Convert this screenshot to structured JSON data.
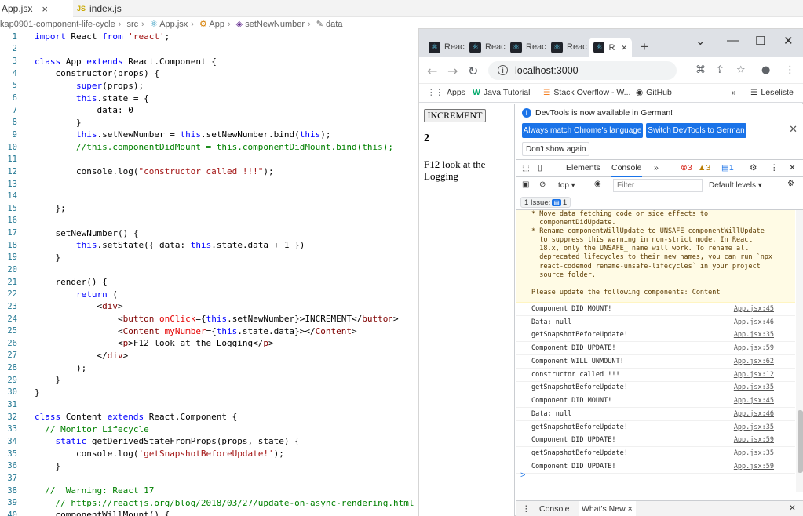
{
  "editor": {
    "tabs": [
      {
        "icon": "JS",
        "label": "App.jsx",
        "close": "×"
      },
      {
        "icon": "JS",
        "label": "index.js"
      }
    ],
    "breadcrumb": [
      "kap0901-component-life-cycle",
      "src",
      "App.jsx",
      "App",
      "setNewNumber",
      "data"
    ],
    "lines": [
      {
        "n": "1",
        "t": "import React from 'react';"
      },
      {
        "n": "2",
        "t": ""
      },
      {
        "n": "3",
        "t": "class App extends React.Component {"
      },
      {
        "n": "4",
        "t": "    constructor(props) {"
      },
      {
        "n": "5",
        "t": "        super(props);"
      },
      {
        "n": "6",
        "t": "        this.state = {"
      },
      {
        "n": "7",
        "t": "            data: 0"
      },
      {
        "n": "8",
        "t": "        }"
      },
      {
        "n": "9",
        "t": "        this.setNewNumber = this.setNewNumber.bind(this);"
      },
      {
        "n": "10",
        "t": "        //this.componentDidMount = this.componentDidMount.bind(this);"
      },
      {
        "n": "11",
        "t": ""
      },
      {
        "n": "12",
        "t": "        console.log(\"constructor called !!!\");"
      },
      {
        "n": "13",
        "t": ""
      },
      {
        "n": "14",
        "t": ""
      },
      {
        "n": "15",
        "t": "    };"
      },
      {
        "n": "16",
        "t": ""
      },
      {
        "n": "17",
        "t": "    setNewNumber() {"
      },
      {
        "n": "18",
        "t": "        this.setState({ data: this.state.data + 1 })"
      },
      {
        "n": "19",
        "t": "    }"
      },
      {
        "n": "20",
        "t": ""
      },
      {
        "n": "21",
        "t": "    render() {"
      },
      {
        "n": "22",
        "t": "        return ("
      },
      {
        "n": "23",
        "t": "            <div>"
      },
      {
        "n": "24",
        "t": "                <button onClick={this.setNewNumber}>INCREMENT</button>"
      },
      {
        "n": "25",
        "t": "                <Content myNumber={this.state.data}></Content>"
      },
      {
        "n": "26",
        "t": "                <p>F12 look at the Logging</p>"
      },
      {
        "n": "27",
        "t": "            </div>"
      },
      {
        "n": "28",
        "t": "        );"
      },
      {
        "n": "29",
        "t": "    }"
      },
      {
        "n": "30",
        "t": "}"
      },
      {
        "n": "31",
        "t": ""
      },
      {
        "n": "32",
        "t": "class Content extends React.Component {"
      },
      {
        "n": "33",
        "t": "  // Monitor Lifecycle"
      },
      {
        "n": "34",
        "t": "    static getDerivedStateFromProps(props, state) {"
      },
      {
        "n": "35",
        "t": "        console.log('getSnapshotBeforeUpdate!');"
      },
      {
        "n": "36",
        "t": "    }"
      },
      {
        "n": "37",
        "t": ""
      },
      {
        "n": "38",
        "t": "  //  Warning: React 17"
      },
      {
        "n": "39",
        "t": "    // https://reactjs.org/blog/2018/03/27/update-on-async-rendering.html"
      },
      {
        "n": "40",
        "t": "    componentWillMount() {"
      }
    ]
  },
  "browser": {
    "tabs": [
      "Reac",
      "Reac",
      "Reac",
      "Reac",
      "R"
    ],
    "active_close": "×",
    "new_tab": "+",
    "url": "localhost:3000",
    "bookmarks": [
      "Apps",
      "Java Tutorial",
      "Stack Overflow - W...",
      "GitHub"
    ],
    "reading_list": "Leseliste",
    "more": "»",
    "page": {
      "button": "INCREMENT",
      "number": "2",
      "text": "F12 look at the Logging"
    },
    "devtools": {
      "info": "DevTools is now available in German!",
      "btn_match": "Always match Chrome's language",
      "btn_switch": "Switch DevTools to German",
      "btn_dont": "Don't show again",
      "tabs": [
        "Elements",
        "Console",
        "»"
      ],
      "errors": "3",
      "warnings": "3",
      "messages": "1",
      "context": "top ▾",
      "filter_placeholder": "Filter",
      "levels": "Default levels ▾",
      "issues": "1 Issue:",
      "issues_count": "1",
      "warning_text": "* Move data fetching code or side effects to\n  componentDidUpdate.\n* Rename componentWillUpdate to UNSAFE_componentWillUpdate\n  to suppress this warning in non-strict mode. In React\n  18.x, only the UNSAFE_ name will work. To rename all\n  deprecated lifecycles to their new names, you can run `npx\n  react-codemod rename-unsafe-lifecycles` in your project\n  source folder.\n\nPlease update the following components: Content",
      "logs": [
        {
          "msg": "Component DID MOUNT!",
          "src": "App.jsx:45"
        },
        {
          "msg": "Data: null",
          "src": "App.jsx:46"
        },
        {
          "msg": "getSnapshotBeforeUpdate!",
          "src": "App.jsx:35"
        },
        {
          "msg": "Component DID UPDATE!",
          "src": "App.jsx:59"
        },
        {
          "msg": "Component WILL UNMOUNT!",
          "src": "App.jsx:62"
        },
        {
          "msg": "constructor called !!!",
          "src": "App.jsx:12"
        },
        {
          "msg": "getSnapshotBeforeUpdate!",
          "src": "App.jsx:35"
        },
        {
          "msg": "Component DID MOUNT!",
          "src": "App.jsx:45"
        },
        {
          "msg": "Data: null",
          "src": "App.jsx:46"
        },
        {
          "msg": "getSnapshotBeforeUpdate!",
          "src": "App.jsx:35"
        },
        {
          "msg": "Component DID UPDATE!",
          "src": "App.jsx:59"
        },
        {
          "msg": "getSnapshotBeforeUpdate!",
          "src": "App.jsx:35"
        },
        {
          "msg": "Component DID UPDATE!",
          "src": "App.jsx:59"
        }
      ],
      "prompt": ">",
      "drawer_tabs": [
        "Console",
        "What's New"
      ],
      "drawer_close": "×"
    }
  },
  "colors": {
    "keyword": "#0000ff",
    "string": "#a31515",
    "comment": "#008000",
    "accent": "#1a73e8"
  }
}
